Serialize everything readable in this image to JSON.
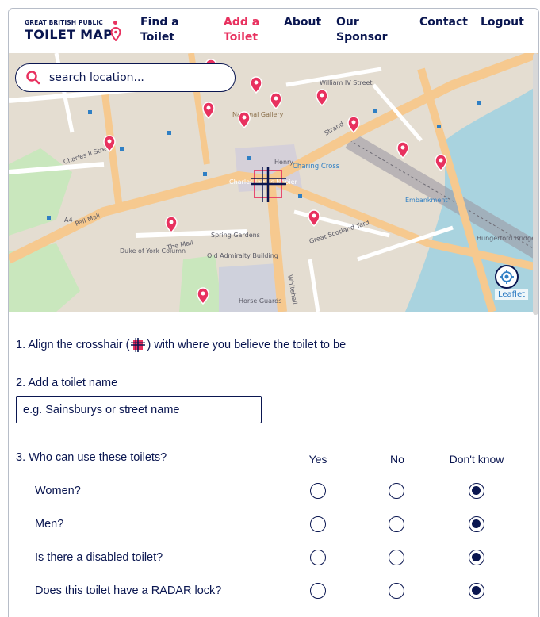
{
  "logo": {
    "line1": "GREAT BRITISH PUBLIC",
    "line2": "TOILET MAP"
  },
  "nav": {
    "find": {
      "line1": "Find a",
      "line2": "Toilet"
    },
    "add": {
      "line1": "Add a",
      "line2": "Toilet"
    },
    "about": "About",
    "sponsor": {
      "line1": "Our",
      "line2": "Sponsor"
    },
    "contact": "Contact",
    "logout": "Logout"
  },
  "map": {
    "search_placeholder": "search location...",
    "labels": {
      "national_gallery": "National Gallery",
      "charing_cross": "Charing Cross",
      "charles_napier": "Charles James Napier",
      "henry": "Henry",
      "whitehall": "Whitehall",
      "pall_mall": "Pall Mall",
      "the_mall": "The Mall",
      "spring_gardens": "Spring Gardens",
      "old_admiralty": "Old Admiralty Building",
      "horse_guards": "Horse Guards",
      "embankment": "Embankment",
      "hungerford": "Hungerford Bridge",
      "strand": "Strand",
      "william_iv": "William IV Street",
      "great_scotland": "Great Scotland Yard",
      "duke_of_york": "Duke of York Column",
      "charles_ii": "Charles II Street",
      "a4": "A4"
    },
    "attribution": "Leaflet"
  },
  "form": {
    "step1": {
      "before": "1. Align the crosshair (",
      "after": ") with where you believe the toilet to be"
    },
    "step2": "2. Add a toilet name",
    "name_placeholder": "e.g. Sainsburys or street name",
    "step3": "3. Who can use these toilets?",
    "columns": [
      "Yes",
      "No",
      "Don't know"
    ],
    "questions": [
      {
        "label": "Women?",
        "selected": "Don't know"
      },
      {
        "label": "Men?",
        "selected": "Don't know"
      },
      {
        "label": "Is there a disabled toilet?",
        "selected": "Don't know"
      },
      {
        "label": "Does this toilet have a RADAR lock?",
        "selected": "Don't know"
      }
    ]
  },
  "colors": {
    "navy": "#0a1650",
    "accent": "#e8315f",
    "road": "#f6c98f",
    "park": "#c9e7bd",
    "water": "#a9d3df"
  }
}
